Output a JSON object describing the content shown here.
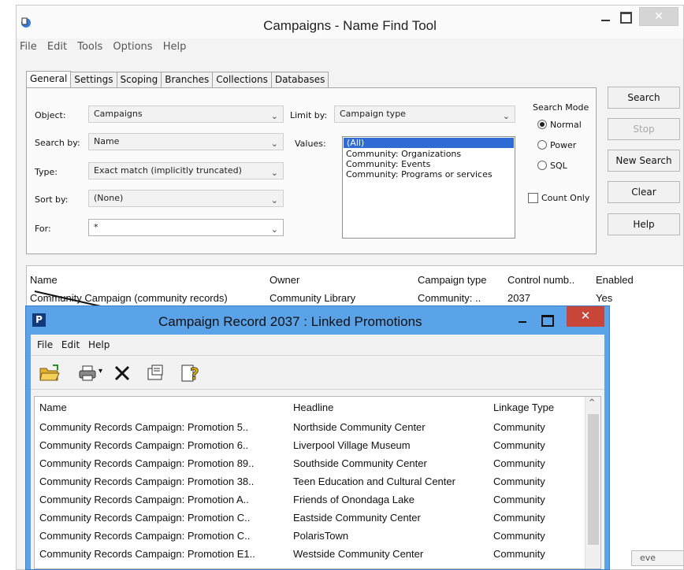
{
  "main": {
    "title": "Campaigns - Name Find Tool",
    "menu": [
      "File",
      "Edit",
      "Tools",
      "Options",
      "Help"
    ],
    "tabs": [
      "General",
      "Settings",
      "Scoping",
      "Branches",
      "Collections",
      "Databases"
    ],
    "form": {
      "object_label": "Object:",
      "object_value": "Campaigns",
      "search_by_label": "Search by:",
      "search_by_value": "Name",
      "type_label": "Type:",
      "type_value": "Exact match (implicitly truncated)",
      "sort_by_label": "Sort by:",
      "sort_by_value": "(None)",
      "for_label": "For:",
      "for_value": "*",
      "limit_by_label": "Limit by:",
      "limit_by_value": "Campaign type",
      "values_label": "Values:",
      "values": [
        "(All)",
        "Community: Organizations",
        "Community: Events",
        "Community: Programs or services"
      ]
    },
    "search_mode": {
      "title": "Search Mode",
      "options": [
        "Normal",
        "Power",
        "SQL"
      ],
      "selected": "Normal"
    },
    "count_only_label": "Count Only",
    "buttons": {
      "search": "Search",
      "stop": "Stop",
      "new_search": "New Search",
      "clear": "Clear",
      "help": "Help"
    },
    "results": {
      "columns": [
        "Name",
        "Owner",
        "Campaign type",
        "Control numb..",
        "Enabled"
      ],
      "rows": [
        [
          "Community Campaign (community records)",
          "Community Library",
          "Community: ..",
          "2037",
          "Yes"
        ]
      ]
    },
    "status_peek": "eve"
  },
  "child": {
    "title": "Campaign Record 2037 : Linked Promotions",
    "menu": [
      "File",
      "Edit",
      "Help"
    ],
    "toolbar": [
      "open-folder-icon",
      "print-icon",
      "delete-icon",
      "properties-icon",
      "help-query-icon"
    ],
    "columns": [
      "Name",
      "Headline",
      "Linkage Type"
    ],
    "rows": [
      [
        "Community Records Campaign: Promotion 5..",
        "Northside Community Center",
        "Community"
      ],
      [
        "Community Records Campaign: Promotion 6..",
        "Liverpool Village Museum",
        "Community"
      ],
      [
        "Community Records Campaign: Promotion 89..",
        "Southside Community Center",
        "Community"
      ],
      [
        "Community Records Campaign: Promotion 38..",
        "Teen Education and Cultural Center",
        "Community"
      ],
      [
        "Community Records Campaign: Promotion A..",
        "Friends of Onondaga Lake",
        "Community"
      ],
      [
        "Community Records Campaign: Promotion C..",
        "Eastside Community Center",
        "Community"
      ],
      [
        "Community Records Campaign: Promotion C..",
        "PolarisTown",
        "Community"
      ],
      [
        "Community Records Campaign: Promotion E1..",
        "Westside Community Center",
        "Community"
      ]
    ]
  }
}
